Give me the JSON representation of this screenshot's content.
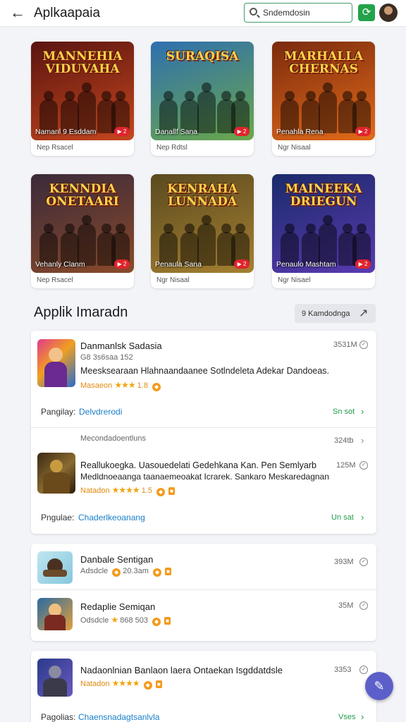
{
  "header": {
    "back_icon": "back-arrow-icon",
    "title": "Aplkaapaia",
    "search_value": "Sndemdosin",
    "refresh_icon": "refresh-icon"
  },
  "games": [
    {
      "logo": "MANNEHIA VIDUVAHA",
      "name": "Namanl 9 Esddam",
      "sub": "Nep Rsacel",
      "play": "▶ 2",
      "bg": [
        "#5a1410",
        "#c5471e"
      ]
    },
    {
      "logo": "SURAQISA",
      "name": "Danallf Sana",
      "sub": "Nep Rdtsl",
      "play": "▶ 2",
      "bg": [
        "#2f6fb0",
        "#6aa84a"
      ]
    },
    {
      "logo": "MARHALLA CHERNAS",
      "name": "Penahla Rena",
      "sub": "Ngr Nisaal",
      "play": "▶ 2",
      "bg": [
        "#7a2a0e",
        "#e36b1a"
      ]
    },
    {
      "logo": "KENNDIA ONETAARI",
      "name": "Vehanly Clanm",
      "sub": "Nep Rsacel",
      "play": "▶ 2",
      "bg": [
        "#3a2a3a",
        "#8a4a2a"
      ]
    },
    {
      "logo": "KENRAHA LUNNADA",
      "name": "Penaula Sana",
      "sub": "Ngr Nisaal",
      "play": "▶ 2",
      "bg": [
        "#5a4a20",
        "#a68030"
      ]
    },
    {
      "logo": "MAINEEKA DRIEGUN",
      "name": "Penaulo Mashtam",
      "sub": "Ngr Nisael",
      "play": "▶ 2",
      "bg": [
        "#1a2a6a",
        "#5a3ab0"
      ]
    }
  ],
  "section": {
    "title": "Applik Imaradn",
    "button_label": "9 Kamdodnga"
  },
  "list_panel_1": {
    "item1": {
      "name": "Danmanlsk Sadasia",
      "meta": "G8 3s6saa 152",
      "desc": "Meesksearaan Hlahnaandaanee Sotlndeleta Adekar Dandoeas.",
      "rating_src": "Masaeon",
      "rating_num": "1.8",
      "size": "3531M",
      "platform_label": "Pangilay:",
      "platform_value": "Delvdrerodi",
      "action": "Sn sot"
    },
    "group_label": "Mecondadoentluns",
    "group_size": "324tb",
    "item2": {
      "name": "Reallukoegka. Uasouedelati Gedehkana Kan. Pen Semlyarb",
      "desc": "Medldnoeaanga taanaemeoakat Icrarek. Sankaro Meskaredagnan",
      "rating_src": "Natadon",
      "rating_num": "1.5",
      "size": "125M",
      "platform_label": "Pngulae:",
      "platform_value": "Chaderlkeoanang",
      "action": "Un sat"
    }
  },
  "list_panel_2": {
    "item1": {
      "name": "Danbale Sentigan",
      "meta": "Adsdcle",
      "meta2": "20.3am",
      "size": "393M"
    },
    "item2": {
      "name": "Redaplie Semiqan",
      "meta": "Odsdcle",
      "meta2": "868 503",
      "size": "35M"
    }
  },
  "list_panel_3": {
    "item1": {
      "name": "Nadaonlnian Banlaon laera Ontaekan Isgddatdsle",
      "rating_src": "Natadon",
      "size": "3353",
      "platform_label": "Pagolias:",
      "platform_value": "Chaensnadagtsanlvla",
      "action": "Vses"
    }
  },
  "fab_icon": "edit-icon"
}
